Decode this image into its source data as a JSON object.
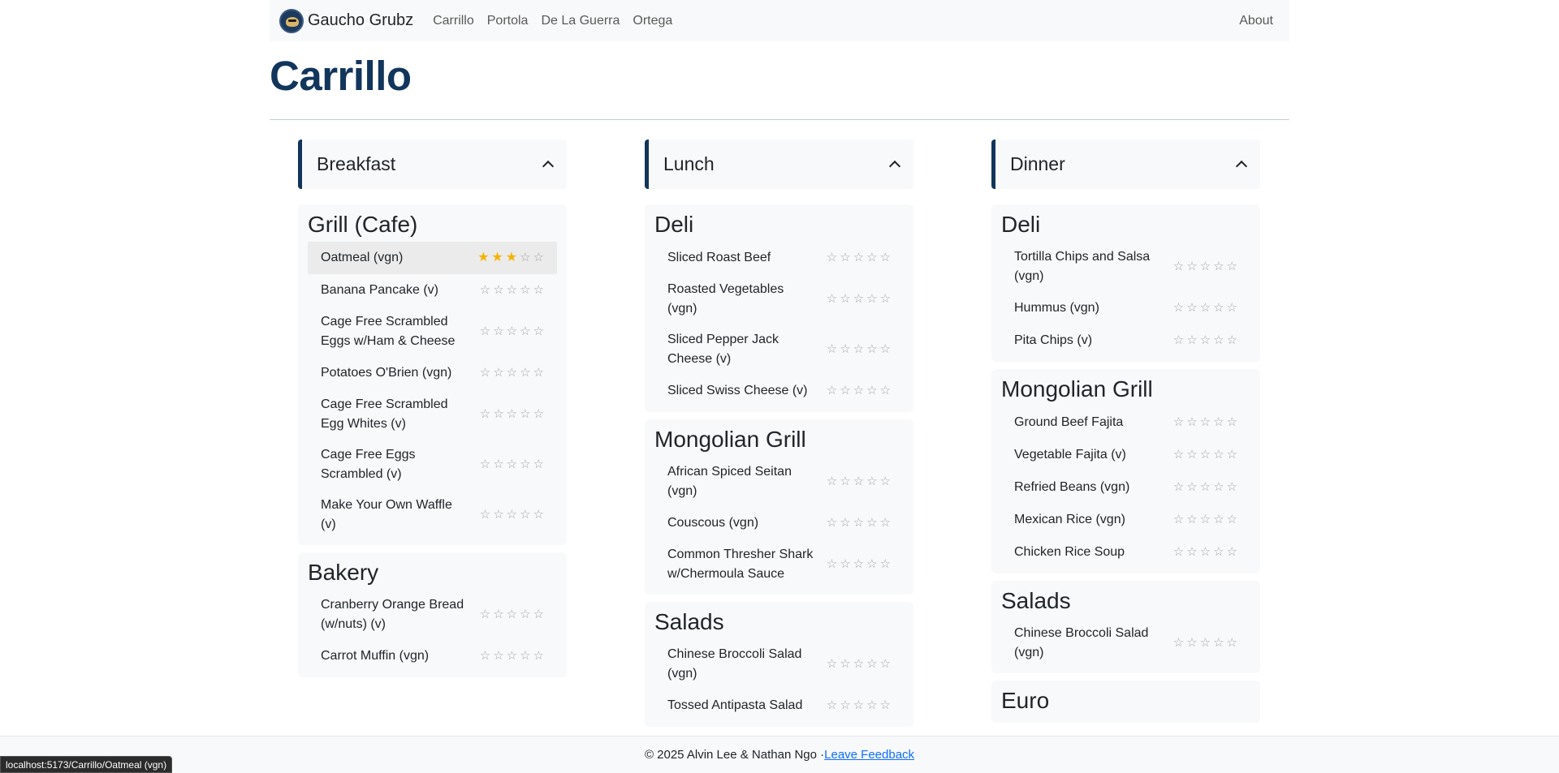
{
  "navbar": {
    "brand": "Gaucho Grubz",
    "links": [
      "Carrillo",
      "Portola",
      "De La Guerra",
      "Ortega"
    ],
    "about": "About"
  },
  "page": {
    "title": "Carrillo"
  },
  "columns": [
    {
      "title": "Breakfast",
      "stations": [
        {
          "name": "Grill (Cafe)",
          "items": [
            {
              "name": "Oatmeal (vgn)",
              "rating": 3
            },
            {
              "name": "Banana Pancake (v)",
              "rating": 0
            },
            {
              "name": "Cage Free Scrambled Eggs w/Ham & Cheese",
              "rating": 0
            },
            {
              "name": "Potatoes O'Brien (vgn)",
              "rating": 0
            },
            {
              "name": "Cage Free Scrambled Egg Whites (v)",
              "rating": 0
            },
            {
              "name": "Cage Free Eggs Scrambled (v)",
              "rating": 0
            },
            {
              "name": "Make Your Own Waffle (v)",
              "rating": 0
            }
          ]
        },
        {
          "name": "Bakery",
          "items": [
            {
              "name": "Cranberry Orange Bread (w/nuts) (v)",
              "rating": 0
            },
            {
              "name": "Carrot Muffin (vgn)",
              "rating": 0
            }
          ]
        }
      ]
    },
    {
      "title": "Lunch",
      "stations": [
        {
          "name": "Deli",
          "items": [
            {
              "name": "Sliced Roast Beef",
              "rating": 0
            },
            {
              "name": "Roasted Vegetables (vgn)",
              "rating": 0
            },
            {
              "name": "Sliced Pepper Jack Cheese (v)",
              "rating": 0
            },
            {
              "name": "Sliced Swiss Cheese (v)",
              "rating": 0
            }
          ]
        },
        {
          "name": "Mongolian Grill",
          "items": [
            {
              "name": "African Spiced Seitan (vgn)",
              "rating": 0
            },
            {
              "name": "Couscous (vgn)",
              "rating": 0
            },
            {
              "name": "Common Thresher Shark w/Chermoula Sauce",
              "rating": 0
            }
          ]
        },
        {
          "name": "Salads",
          "items": [
            {
              "name": "Chinese Broccoli Salad (vgn)",
              "rating": 0
            },
            {
              "name": "Tossed Antipasta Salad",
              "rating": 0
            }
          ]
        }
      ]
    },
    {
      "title": "Dinner",
      "stations": [
        {
          "name": "Deli",
          "items": [
            {
              "name": "Tortilla Chips and Salsa (vgn)",
              "rating": 0
            },
            {
              "name": "Hummus (vgn)",
              "rating": 0
            },
            {
              "name": "Pita Chips (v)",
              "rating": 0
            }
          ]
        },
        {
          "name": "Mongolian Grill",
          "items": [
            {
              "name": "Ground Beef Fajita",
              "rating": 0
            },
            {
              "name": "Vegetable Fajita (v)",
              "rating": 0
            },
            {
              "name": "Refried Beans (vgn)",
              "rating": 0
            },
            {
              "name": "Mexican Rice (vgn)",
              "rating": 0
            },
            {
              "name": "Chicken Rice Soup",
              "rating": 0
            }
          ]
        },
        {
          "name": "Salads",
          "items": [
            {
              "name": "Chinese Broccoli Salad (vgn)",
              "rating": 0
            }
          ]
        },
        {
          "name": "Euro",
          "items": []
        }
      ]
    }
  ],
  "highlighted_item": "Oatmeal (vgn)",
  "footer": {
    "text": "© 2025 Alvin Lee & Nathan Ngo · ",
    "link": "Leave Feedback"
  },
  "status_bar": "localhost:5173/Carrillo/Oatmeal (vgn)",
  "colors": {
    "title": "#12355b",
    "star_on": "#f5b301",
    "star_off": "#a6a6a6",
    "link": "#0d6efd"
  }
}
